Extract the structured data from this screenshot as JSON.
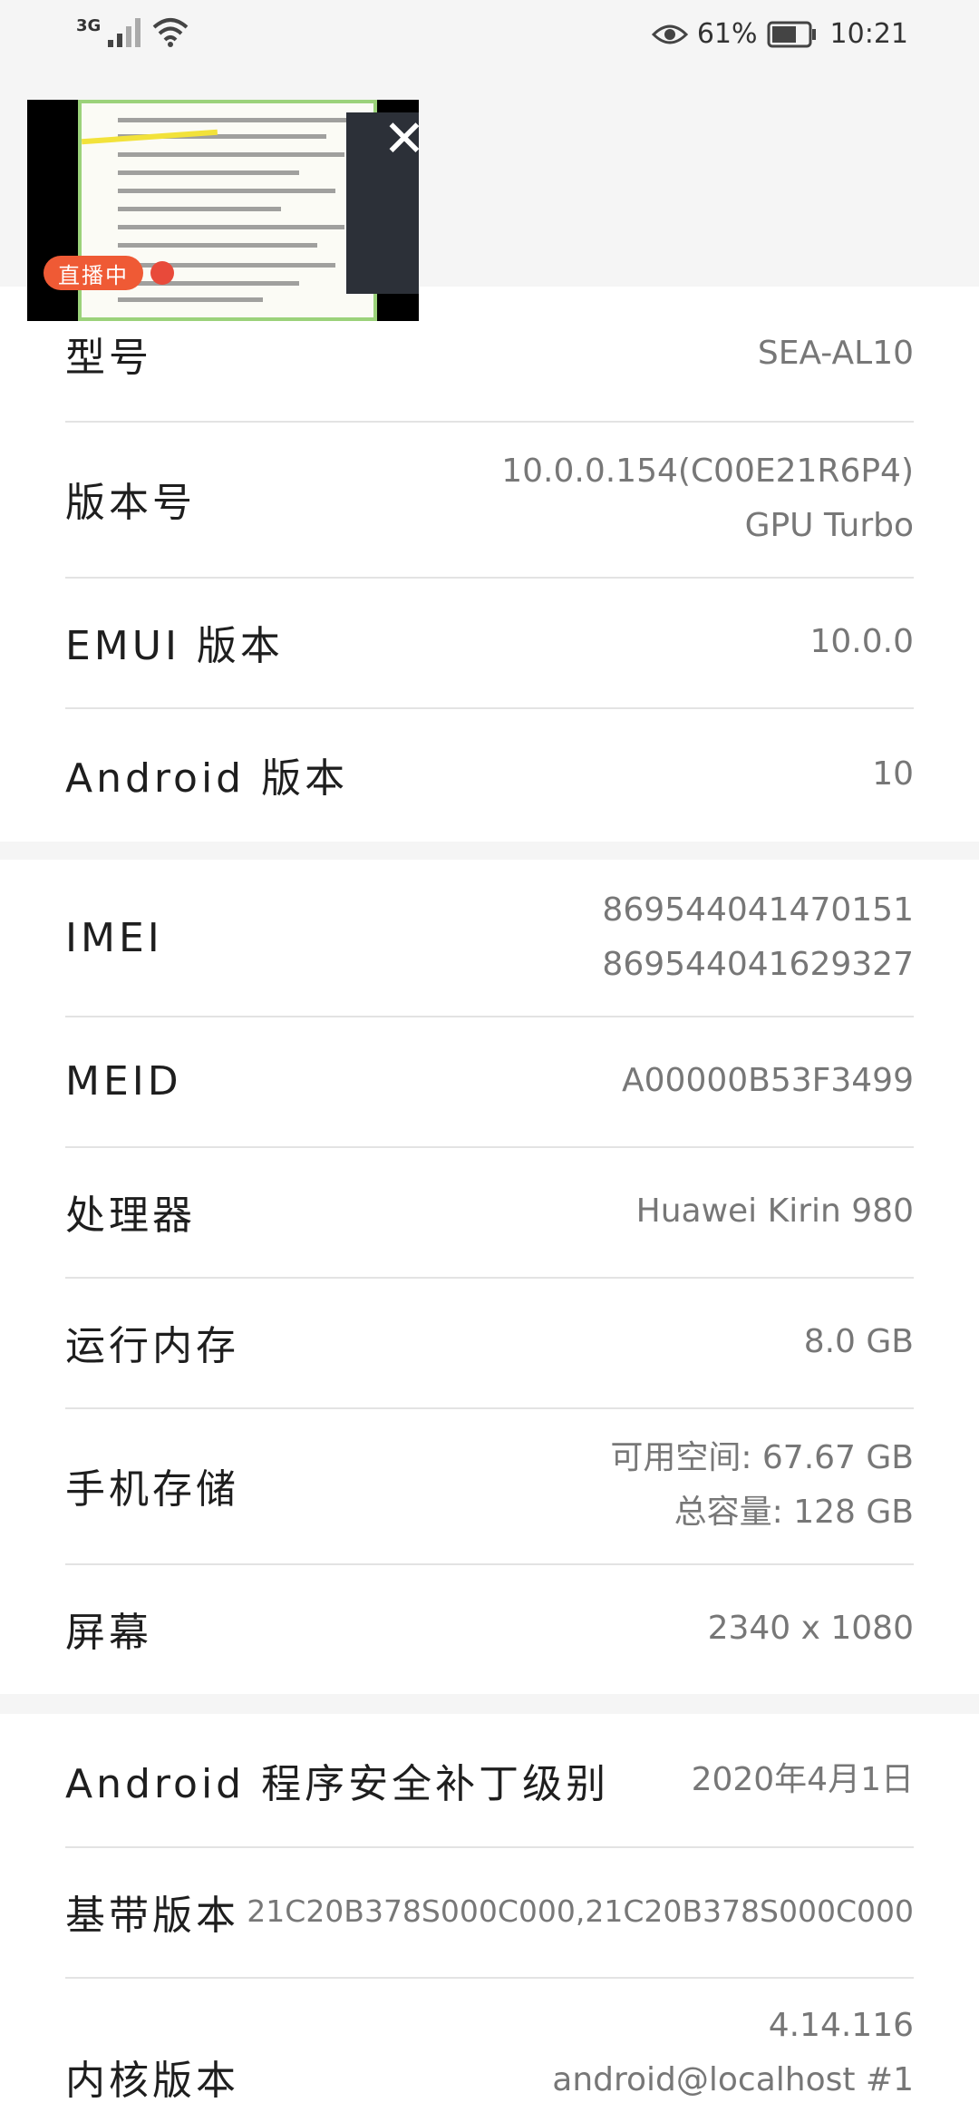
{
  "status_bar": {
    "network": "3G",
    "battery_percent": "61%",
    "time": "10:21"
  },
  "pip": {
    "live_label": "直播中"
  },
  "section1": {
    "rows": [
      {
        "label": "型号",
        "value": "SEA-AL10"
      },
      {
        "label": "版本号",
        "value_lines": [
          "10.0.0.154(C00E21R6P4)",
          "GPU Turbo"
        ]
      },
      {
        "label": "EMUI 版本",
        "value": "10.0.0"
      },
      {
        "label": "Android 版本",
        "value": "10"
      }
    ]
  },
  "section2": {
    "rows": [
      {
        "label": "IMEI",
        "value_lines": [
          "869544041470151",
          "869544041629327"
        ]
      },
      {
        "label": "MEID",
        "value": "A00000B53F3499"
      },
      {
        "label": "处理器",
        "value": "Huawei Kirin 980"
      },
      {
        "label": "运行内存",
        "value": "8.0 GB"
      },
      {
        "label": "手机存储",
        "value_lines": [
          "可用空间: 67.67 GB",
          "总容量: 128 GB"
        ]
      },
      {
        "label": "屏幕",
        "value": "2340 x 1080"
      }
    ]
  },
  "section3": {
    "rows": [
      {
        "label": "Android 程序安全补丁级别",
        "value": "2020年4月1日"
      },
      {
        "label": "基带版本",
        "value": "21C20B378S000C000,21C20B378S000C000"
      },
      {
        "label": "内核版本",
        "value_lines": [
          "4.14.116",
          "android@localhost #1"
        ]
      }
    ]
  }
}
